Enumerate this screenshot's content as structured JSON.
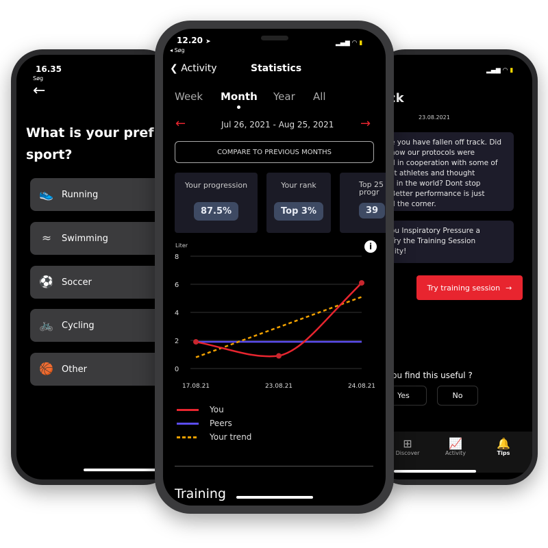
{
  "colors": {
    "accent": "#e8252f",
    "peers": "#5b4cf0",
    "trend": "#f0a000",
    "card": "#1d1c2a",
    "pill": "#3e4a63"
  },
  "left_phone": {
    "time": "16.35",
    "back_label": "Søg",
    "title_line1": "What is your pref",
    "title_line2": "sport?",
    "sports": [
      {
        "label": "Running",
        "icon": "shoe-icon"
      },
      {
        "label": "Swimming",
        "icon": "swimmer-icon"
      },
      {
        "label": "Soccer",
        "icon": "soccer-ball-icon"
      },
      {
        "label": "Cycling",
        "icon": "bicycle-icon"
      },
      {
        "label": "Other",
        "icon": "other-sports-icon"
      }
    ]
  },
  "center_phone": {
    "time": "12.20",
    "back_label": "Søg",
    "nav": {
      "back": "Activity",
      "title": "Statistics"
    },
    "tabs": [
      "Week",
      "Month",
      "Year",
      "All"
    ],
    "active_tab": "Month",
    "date_range": "Jul 26, 2021 - Aug 25, 2021",
    "compare_button": "COMPARE TO PREVIOUS MONTHS",
    "stats": [
      {
        "label": "Your progression",
        "value": "87.5%"
      },
      {
        "label": "Your rank",
        "value": "Top 3%"
      },
      {
        "label": "Top 25 progr",
        "value": "39"
      }
    ],
    "section_title": "Training"
  },
  "chart_data": {
    "type": "line",
    "ylabel": "Liter",
    "categories": [
      "17.08.21",
      "23.08.21",
      "24.08.21"
    ],
    "yticks": [
      0,
      2,
      4,
      6,
      8
    ],
    "ylim": [
      0,
      8
    ],
    "grid": true,
    "legend_position": "bottom",
    "series": [
      {
        "name": "You",
        "values": [
          1.9,
          0.9,
          6.1
        ],
        "color": "#e8252f",
        "style": "solid",
        "markers": true
      },
      {
        "name": "Peers",
        "values": [
          1.9,
          1.9,
          1.9
        ],
        "color": "#5b4cf0",
        "style": "solid"
      },
      {
        "name": "Your trend",
        "values": [
          0.8,
          2.95,
          5.1
        ],
        "color": "#f0a000",
        "style": "dashed"
      }
    ]
  },
  "right_phone": {
    "title_fragment": "ck",
    "date": "23.08.2021",
    "message1": [
      "e you have fallen off track. Did",
      "now our protocols were",
      "d in cooperation with some of",
      "st athletes and thought",
      "s in the world? Dont stop",
      "Better performance is just",
      "d the corner."
    ],
    "message2": [
      "ou Inspiratory Pressure a",
      "Try the Training Session",
      "ility!"
    ],
    "cta": "Try training session",
    "question": "you find this useful ?",
    "yes": "Yes",
    "no": "No",
    "tabbar": [
      {
        "label": "Discover",
        "icon": "grid-icon"
      },
      {
        "label": "Activity",
        "icon": "chart-icon"
      },
      {
        "label": "Tips",
        "icon": "bell-icon"
      }
    ]
  }
}
